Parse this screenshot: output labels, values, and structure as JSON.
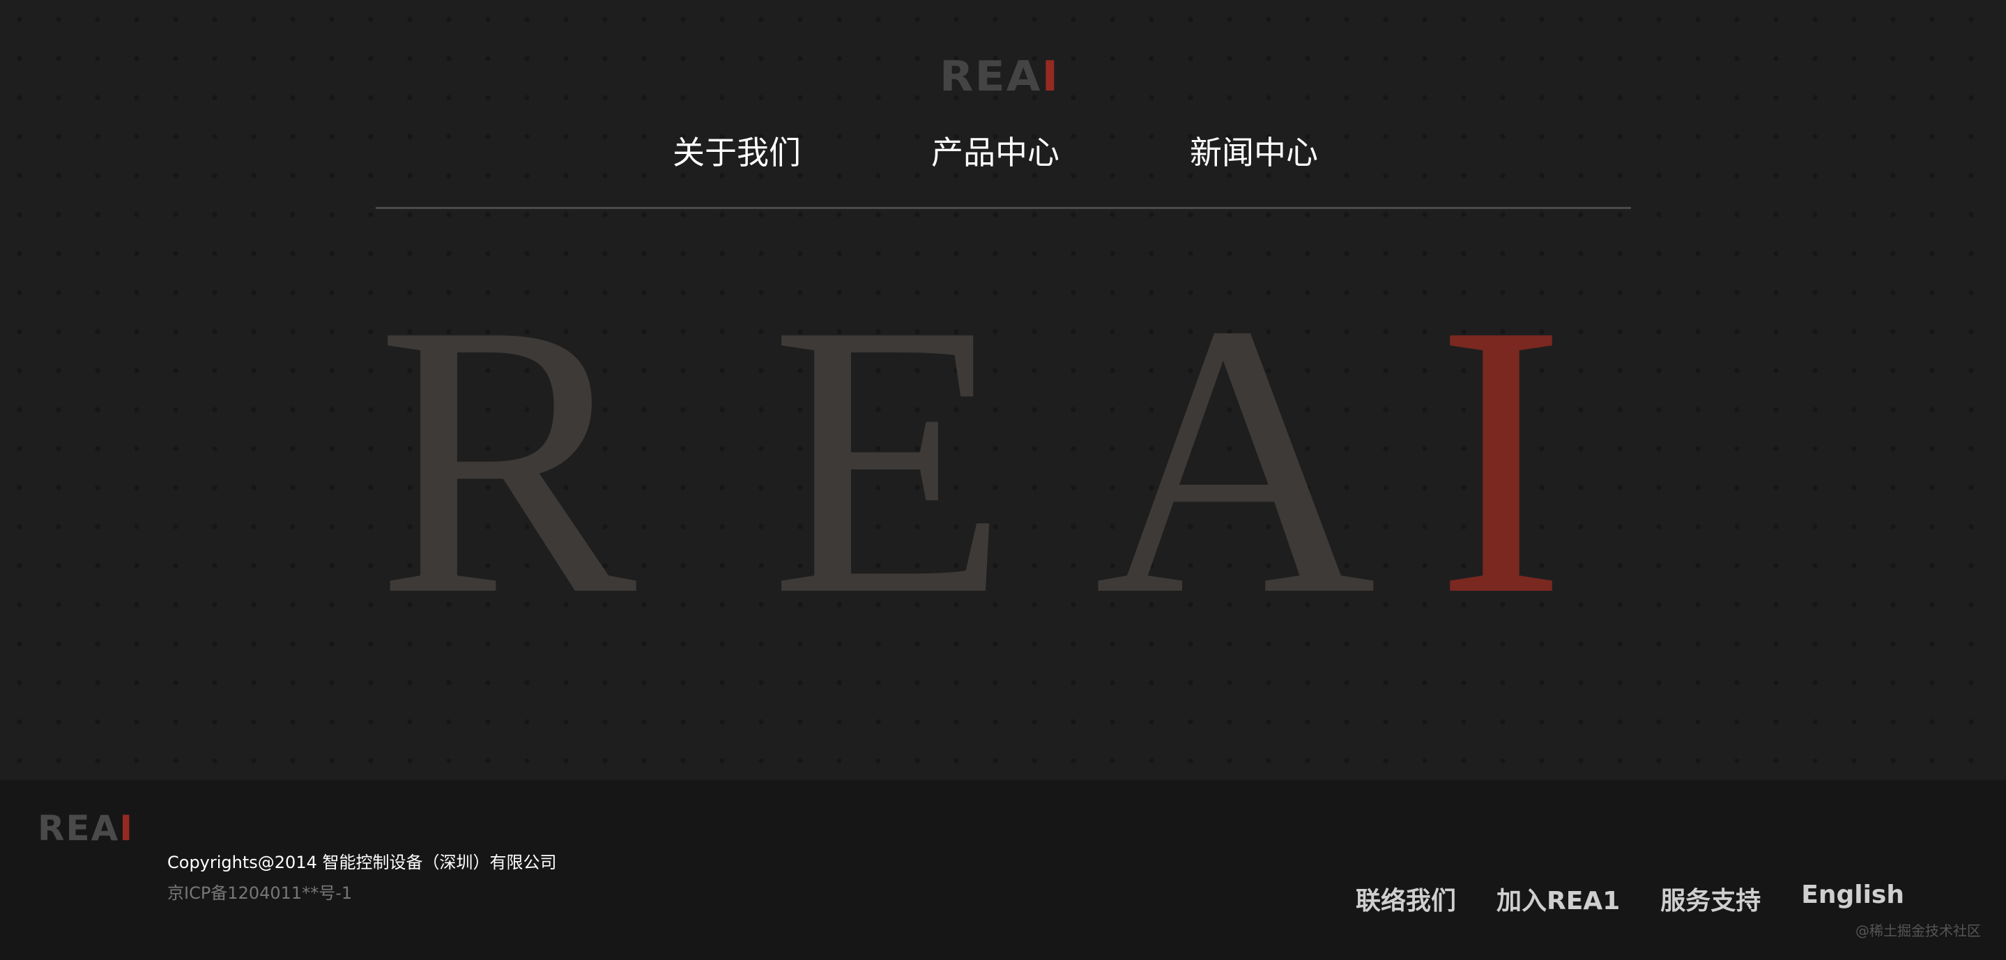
{
  "header": {
    "logo_main": "REA",
    "logo_accent": "I"
  },
  "nav": [
    {
      "label": "关于我们"
    },
    {
      "label": "产品中心"
    },
    {
      "label": "新闻中心"
    }
  ],
  "hero": {
    "letters": [
      "R",
      "E",
      "A",
      "I"
    ],
    "accent_color": "#7a2820",
    "letter_color": "#3d3a37"
  },
  "footer": {
    "logo_main": "REA",
    "logo_accent": "I",
    "copyright": "Copyrights@2014 智能控制设备（深圳）有限公司",
    "icp": "京ICP备1204011**号-1",
    "links": [
      {
        "label": "联络我们"
      },
      {
        "label": "加入REA1"
      },
      {
        "label": "服务支持"
      },
      {
        "label": "English"
      }
    ],
    "watermark": "@稀土掘金技术社区"
  },
  "colors": {
    "background": "#1e1e1f",
    "footer_background": "#161616",
    "accent_red": "#962a22"
  }
}
